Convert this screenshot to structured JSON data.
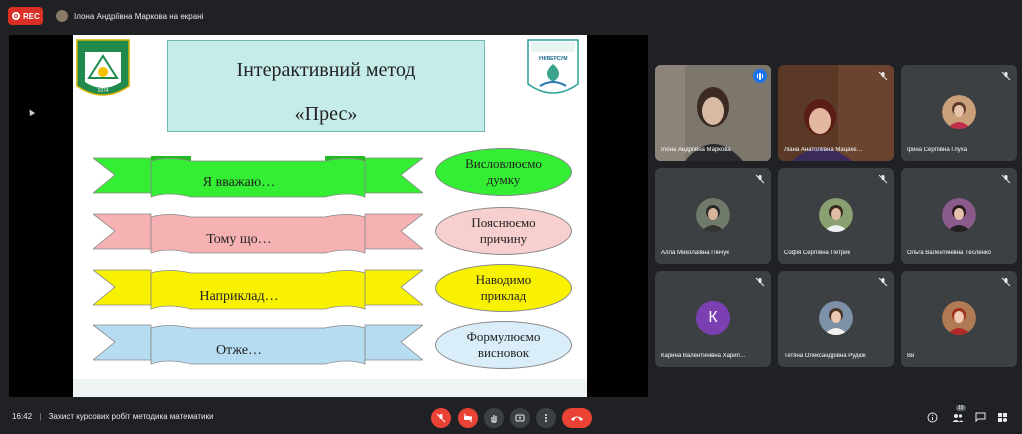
{
  "recording": {
    "label": "REC"
  },
  "presenter": {
    "label": "Ілона Андріївна Маркова на екрані"
  },
  "slide": {
    "title_line1": "Інтерактивний метод",
    "title_line2": "«Прес»",
    "logo_left_text": "1974",
    "logo_right_text": "УНІВЕРСУМ",
    "banners": [
      {
        "label": "Я вважаю…",
        "color": "#33ee33"
      },
      {
        "label": "Тому що…",
        "color": "#f6b2b2"
      },
      {
        "label": "Наприклад…",
        "color": "#f8f200"
      },
      {
        "label": "Отже…",
        "color": "#b5dcf0"
      }
    ],
    "ovals": [
      {
        "line1": "Висловлюємо",
        "line2": "думку",
        "color": "#33ee33"
      },
      {
        "line1": "Пояснюємо",
        "line2": "причину",
        "color": "#f8cfcf"
      },
      {
        "line1": "Наводимо",
        "line2": "приклад",
        "color": "#f8f200"
      },
      {
        "line1": "Формулюємо",
        "line2": "висновок",
        "color": "#d9eef8"
      }
    ]
  },
  "participants": [
    {
      "name": "Ілона Андріївна Маркова",
      "speaking": true
    },
    {
      "name": "Ліана Анатоліївна Мацаке…",
      "speaking": false
    },
    {
      "name": "Ірина Сергіївна Глуха",
      "speaking": false
    },
    {
      "name": "Алла Миколаївна Пінчук",
      "speaking": false
    },
    {
      "name": "Софія Сергіївна Петрик",
      "speaking": false
    },
    {
      "name": "Ольга Валентинівна Тесленко",
      "speaking": false
    },
    {
      "name": "Карина Валентинівна Харип…",
      "avatar_letter": "К",
      "speaking": false
    },
    {
      "name": "Тетяна Олександрівна Рудюк",
      "speaking": false
    },
    {
      "name": "Ви",
      "speaking": false
    }
  ],
  "bottom": {
    "time": "16:42",
    "separator": "|",
    "meeting_title": "Захист курсових робіт методика математики",
    "participant_count": "10"
  },
  "colors": {
    "hangup": "#ea4335",
    "accent": "#8ab4f8",
    "rec": "#d93025"
  },
  "icons": [
    "mic-off-icon",
    "camera-off-icon",
    "hand-icon",
    "present-icon",
    "more-icon",
    "hangup-icon",
    "info-icon",
    "people-icon",
    "chat-icon",
    "activities-icon"
  ]
}
